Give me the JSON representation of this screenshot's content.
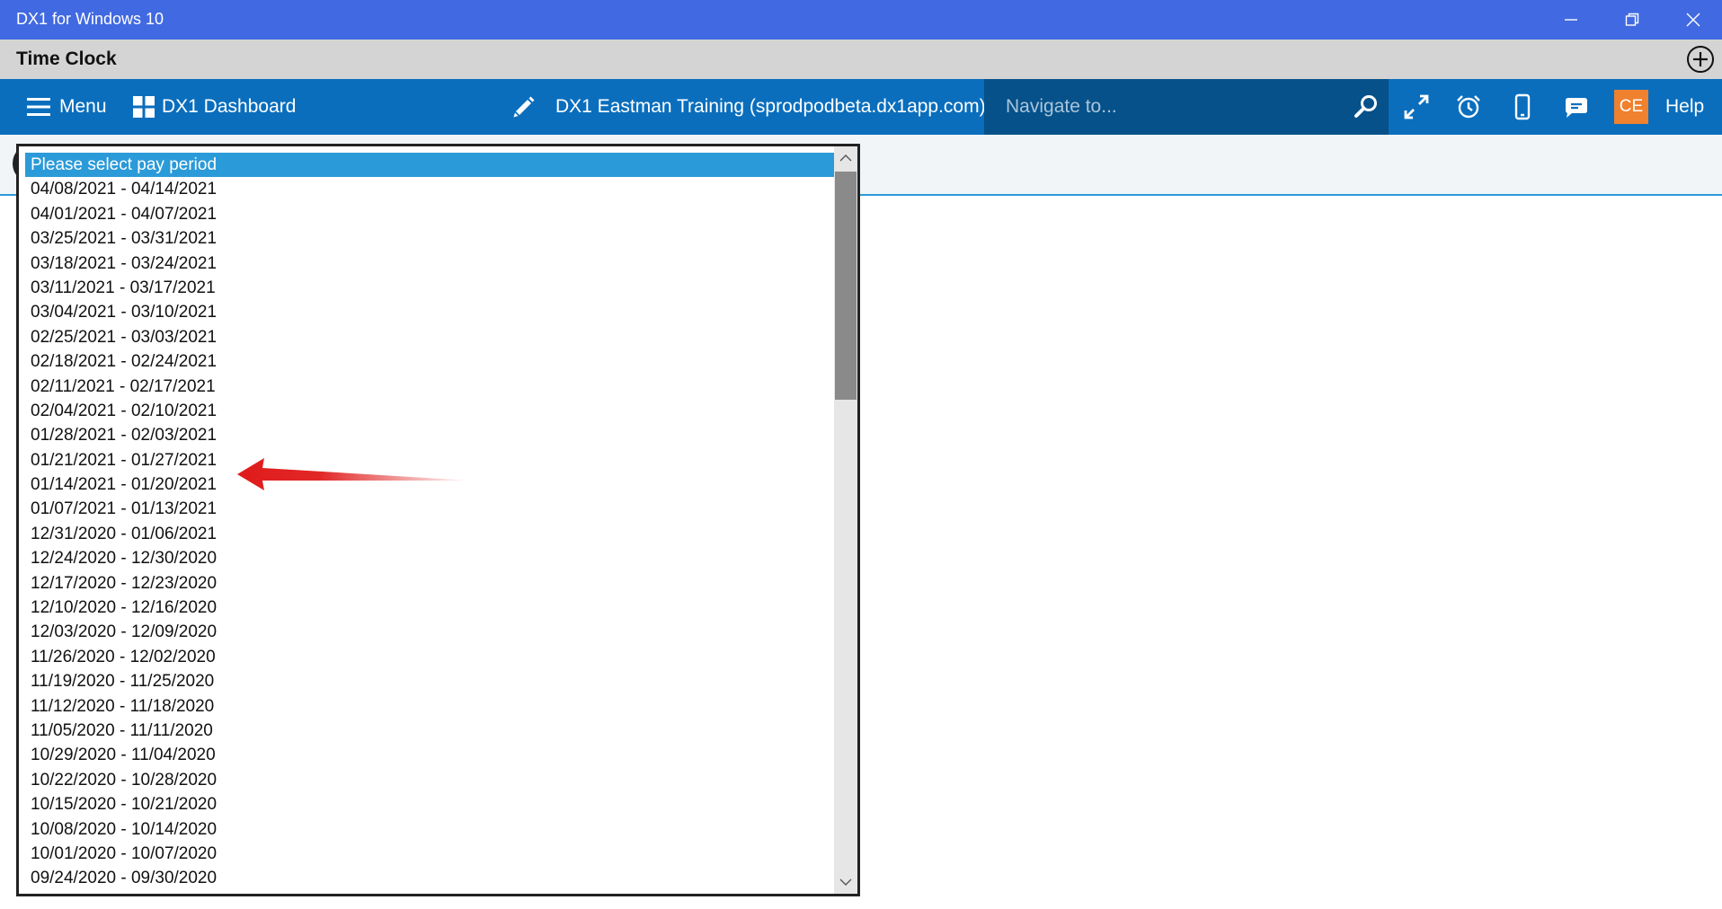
{
  "window": {
    "title": "DX1 for Windows 10"
  },
  "page": {
    "title": "Time Clock"
  },
  "nav": {
    "menu_label": "Menu",
    "dashboard_label": "DX1 Dashboard",
    "site_label": "DX1 Eastman Training (sprodpodbeta.dx1app.com)",
    "search_placeholder": "Navigate to...",
    "avatar_initials": "CE",
    "help_label": "Help"
  },
  "colors": {
    "titlebar": "#4169e1",
    "navbar": "#0a6ebd",
    "search_bg": "#065189",
    "selected": "#2b9ad8",
    "avatar": "#f0812e",
    "annotation_arrow": "#e02020"
  },
  "pay_period_dropdown": {
    "options": [
      "Please select pay period",
      "04/08/2021 - 04/14/2021",
      "04/01/2021 - 04/07/2021",
      "03/25/2021 - 03/31/2021",
      "03/18/2021 - 03/24/2021",
      "03/11/2021 - 03/17/2021",
      "03/04/2021 - 03/10/2021",
      "02/25/2021 - 03/03/2021",
      "02/18/2021 - 02/24/2021",
      "02/11/2021 - 02/17/2021",
      "02/04/2021 - 02/10/2021",
      "01/28/2021 - 02/03/2021",
      "01/21/2021 - 01/27/2021",
      "01/14/2021 - 01/20/2021",
      "01/07/2021 - 01/13/2021",
      "12/31/2020 - 01/06/2021",
      "12/24/2020 - 12/30/2020",
      "12/17/2020 - 12/23/2020",
      "12/10/2020 - 12/16/2020",
      "12/03/2020 - 12/09/2020",
      "11/26/2020 - 12/02/2020",
      "11/19/2020 - 11/25/2020",
      "11/12/2020 - 11/18/2020",
      "11/05/2020 - 11/11/2020",
      "10/29/2020 - 11/04/2020",
      "10/22/2020 - 10/28/2020",
      "10/15/2020 - 10/21/2020",
      "10/08/2020 - 10/14/2020",
      "10/01/2020 - 10/07/2020",
      "09/24/2020 - 09/30/2020"
    ],
    "selected_index": 0
  }
}
